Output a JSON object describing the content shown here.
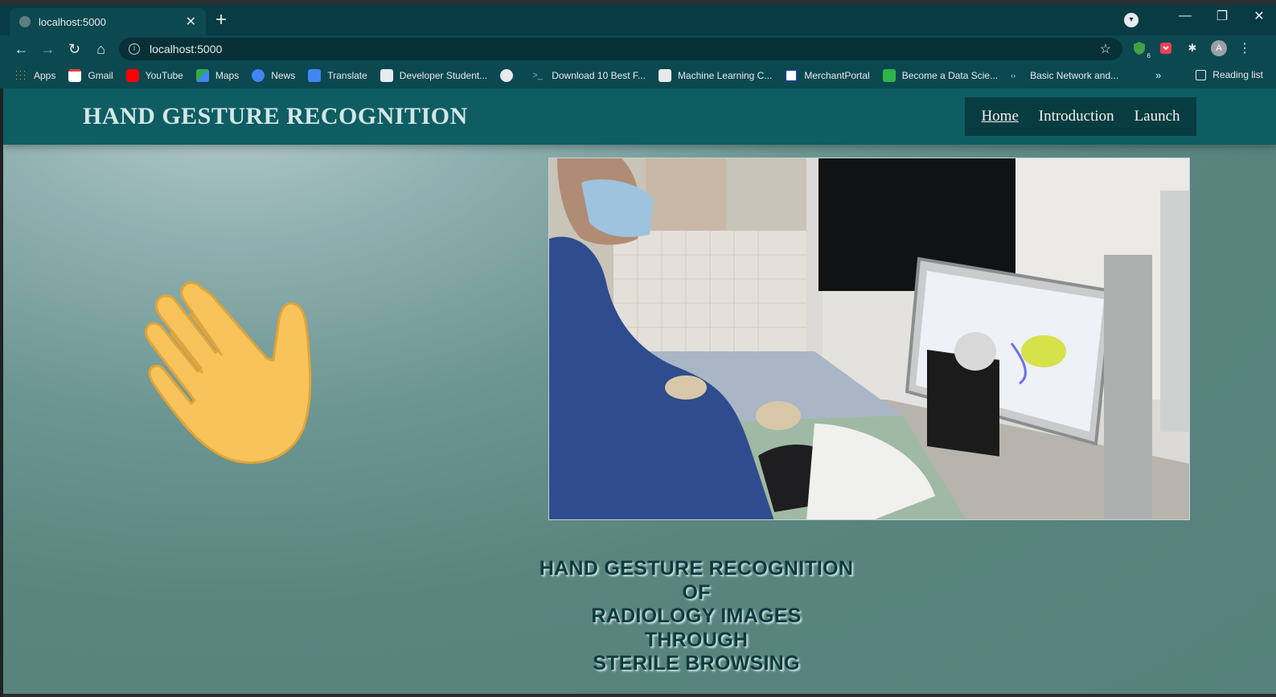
{
  "browser": {
    "tab_title": "localhost:5000",
    "url": "localhost:5000",
    "bookmarks": [
      {
        "label": "Apps",
        "icon": "apps-grid-icon",
        "color": "#f0b23f"
      },
      {
        "label": "Gmail",
        "icon": "gmail-icon",
        "color": "#e3463a"
      },
      {
        "label": "YouTube",
        "icon": "youtube-icon",
        "color": "#ff0000"
      },
      {
        "label": "Maps",
        "icon": "maps-icon",
        "color": "#34a853"
      },
      {
        "label": "News",
        "icon": "news-icon",
        "color": "#4285f4"
      },
      {
        "label": "Translate",
        "icon": "translate-icon",
        "color": "#4285f4"
      },
      {
        "label": "Developer Student...",
        "icon": "dev-icon",
        "color": "#e8eaed"
      },
      {
        "label": "",
        "icon": "globe-icon",
        "color": "#e8eaed"
      },
      {
        "label": "Download 10 Best F...",
        "icon": "terminal-icon",
        "color": "#0b4850"
      },
      {
        "label": "Machine Learning C...",
        "icon": "code-icon",
        "color": "#e8eaed"
      },
      {
        "label": "MerchantPortal",
        "icon": "merchant-icon",
        "color": "#ffffff"
      },
      {
        "label": "Become a Data Scie...",
        "icon": "data-science-icon",
        "color": "#2fb34a"
      },
      {
        "label": "Basic Network and...",
        "icon": "network-icon",
        "color": "#0b4850"
      }
    ],
    "bookmarks_more": "»",
    "reading_list": "Reading list",
    "avatar_letter": "A",
    "extension_badge": "6"
  },
  "site": {
    "title": "HAND GESTURE RECOGNITION",
    "nav": [
      {
        "label": "Home",
        "active": true
      },
      {
        "label": "Introduction",
        "active": false
      },
      {
        "label": "Launch",
        "active": false
      }
    ],
    "caption_lines": [
      "HAND GESTURE RECOGNITION",
      "OF",
      "RADIOLOGY IMAGES",
      "THROUGH",
      "STERILE BROWSING"
    ]
  },
  "colors": {
    "header": "#0e5d63",
    "nav_bg": "#073c40",
    "page_bg": "#5a857f",
    "caption_text": "#0d3b3d"
  }
}
